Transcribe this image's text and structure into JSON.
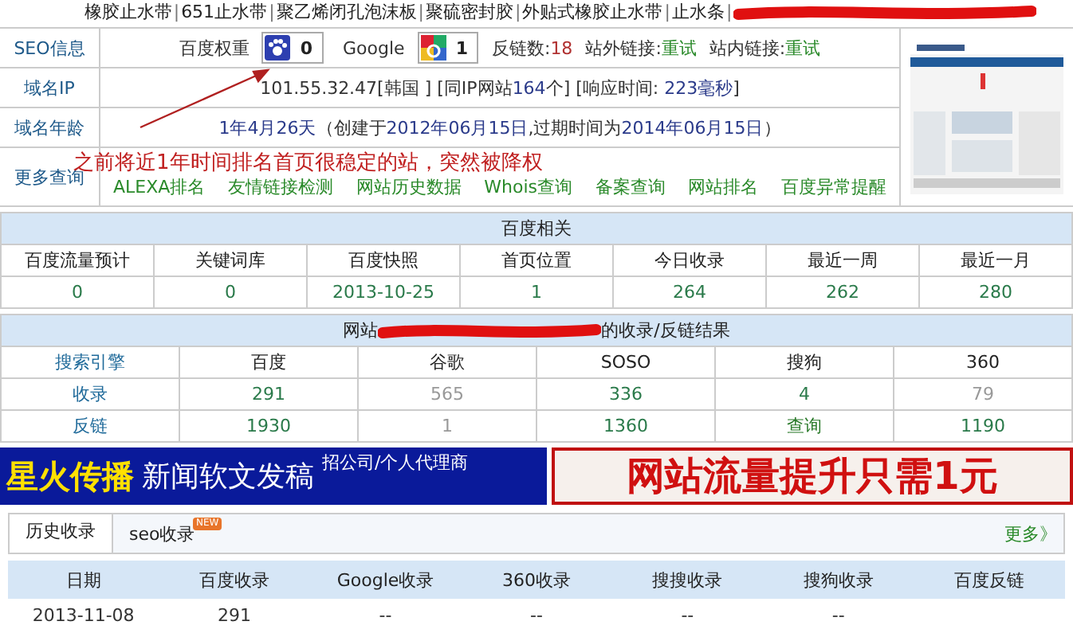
{
  "top_links": [
    {
      "kind": "link",
      "text": "橡胶止水带"
    },
    {
      "kind": "separator",
      "text": "|"
    },
    {
      "kind": "link",
      "text": "651止水带"
    },
    {
      "kind": "separator",
      "text": "|"
    },
    {
      "kind": "link",
      "text": "聚乙烯闭孔泡沫板"
    },
    {
      "kind": "separator",
      "text": "|"
    },
    {
      "kind": "link",
      "text": "聚硫密封胶"
    },
    {
      "kind": "separator",
      "text": "|"
    },
    {
      "kind": "link",
      "text": "外贴式橡胶止水带"
    },
    {
      "kind": "separator",
      "text": "|"
    },
    {
      "kind": "link",
      "text": "止水条"
    },
    {
      "kind": "separator",
      "text": "|"
    }
  ],
  "seo_info": {
    "label": "SEO信息",
    "baidu_weight": {
      "label": "百度权重",
      "value": "0"
    },
    "google_pr": {
      "label": "Google",
      "value": "1"
    },
    "stats": [
      {
        "label": "反链数:",
        "value": "18",
        "kind": "count"
      },
      {
        "label": "站外链接:",
        "value": "重试",
        "kind": "link"
      },
      {
        "label": "站内链接:",
        "value": "重试",
        "kind": "link"
      }
    ]
  },
  "domain_ip": {
    "label": "域名IP",
    "segments": [
      {
        "text": "101.55.32.47[韩国 ]  [同IP网站",
        "kind": "plain"
      },
      {
        "text": "164",
        "kind": "value"
      },
      {
        "text": "个]  [响应时间: ",
        "kind": "plain"
      },
      {
        "text": "223毫秒",
        "kind": "value"
      },
      {
        "text": "]",
        "kind": "plain"
      }
    ]
  },
  "domain_age": {
    "label": "域名年龄",
    "segments": [
      {
        "text": "1年4月26天",
        "kind": "value"
      },
      {
        "text": "（创建于",
        "kind": "plain"
      },
      {
        "text": "2012年06月15日",
        "kind": "value"
      },
      {
        "text": ",过期时间为",
        "kind": "plain"
      },
      {
        "text": "2014年06月15日",
        "kind": "value"
      },
      {
        "text": "）",
        "kind": "plain"
      }
    ]
  },
  "more_queries": {
    "label": "更多查询",
    "links": [
      "ALEXA排名",
      "友情链接检测",
      "网站历史数据",
      "Whois查询",
      "备案查询",
      "网站排名",
      "百度异常提醒"
    ]
  },
  "annotation": "之前将近1年时间排名首页很稳定的站，突然被降权",
  "baidu_section": {
    "title": "百度相关",
    "columns": [
      "百度流量预计",
      "关键词库",
      "百度快照",
      "首页位置",
      "今日收录",
      "最近一周",
      "最近一月"
    ],
    "values": [
      "0",
      "0",
      "2013-10-25",
      "1",
      "264",
      "262",
      "280"
    ]
  },
  "index_section": {
    "title_prefix": "网站",
    "title_suffix": "的收录/反链结果",
    "columns": [
      "搜索引擎",
      "百度",
      "谷歌",
      "SOSO",
      "搜狗",
      "360"
    ],
    "rows": [
      {
        "cells": [
          {
            "text": "收录",
            "kind": "head"
          },
          {
            "text": "291",
            "kind": "value"
          },
          {
            "text": "565",
            "kind": "muted"
          },
          {
            "text": "336",
            "kind": "value"
          },
          {
            "text": "4",
            "kind": "value"
          },
          {
            "text": "79",
            "kind": "muted"
          }
        ]
      },
      {
        "cells": [
          {
            "text": "反链",
            "kind": "head"
          },
          {
            "text": "1930",
            "kind": "value"
          },
          {
            "text": "1",
            "kind": "muted"
          },
          {
            "text": "1360",
            "kind": "value"
          },
          {
            "text": "查询",
            "kind": "link"
          },
          {
            "text": "1190",
            "kind": "value"
          }
        ]
      }
    ]
  },
  "ads": [
    {
      "kind": "blue",
      "brand": "星火传播",
      "headline": "新闻软文发稿",
      "note": "招公司/个人代理商"
    },
    {
      "kind": "red",
      "headline": "网站流量提升只需1元"
    }
  ],
  "history": {
    "tabs": [
      {
        "label": "历史收录",
        "selected": true
      },
      {
        "label": "seo收录",
        "selected": false,
        "badge": "NEW"
      }
    ],
    "more": "更多》",
    "columns": [
      "日期",
      "百度收录",
      "Google收录",
      "360收录",
      "搜搜收录",
      "搜狗收录",
      "百度反链"
    ],
    "rows": [
      [
        "2013-11-08",
        "291",
        "--",
        "--",
        "--",
        "--"
      ]
    ]
  }
}
